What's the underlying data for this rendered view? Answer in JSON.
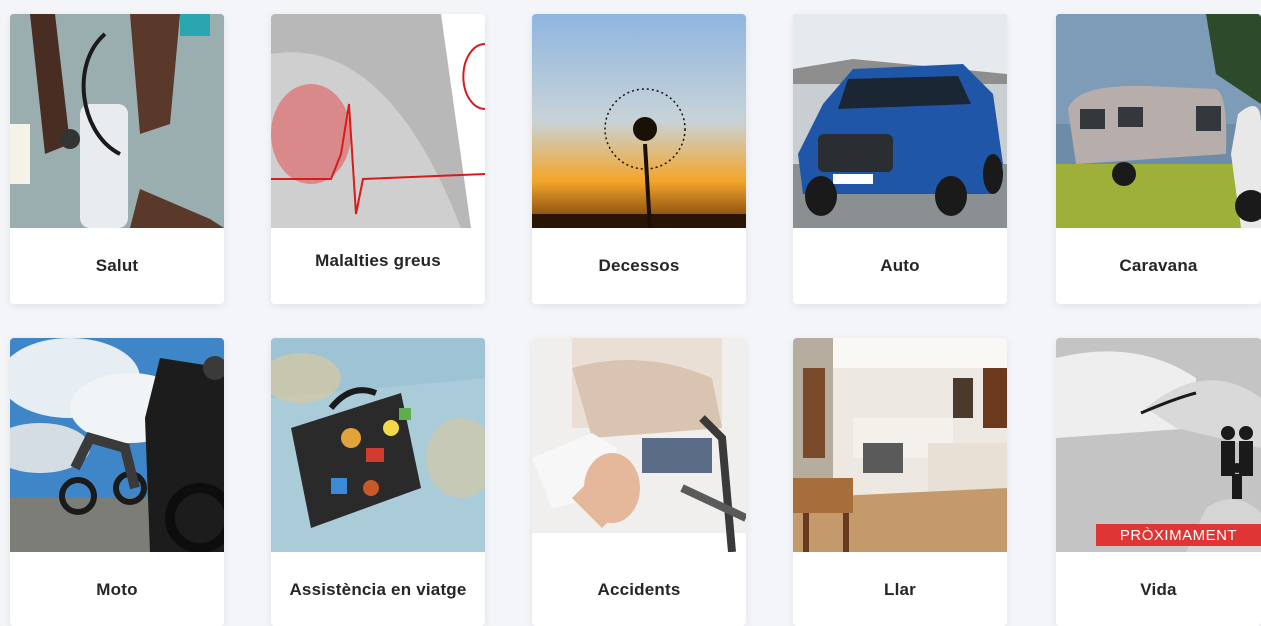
{
  "cards": [
    {
      "label": "Salut",
      "icon": "blood-pressure-photo"
    },
    {
      "label": "Malalties greus",
      "icon": "heartbeat-photo"
    },
    {
      "label": "Decessos",
      "icon": "dandelion-sunset-photo"
    },
    {
      "label": "Auto",
      "icon": "suv-car-photo"
    },
    {
      "label": "Caravana",
      "icon": "caravan-photo"
    },
    {
      "label": "Moto",
      "icon": "motorcycles-photo"
    },
    {
      "label": "Assistència en viatge",
      "icon": "suitcase-map-photo"
    },
    {
      "label": "Accidents",
      "icon": "injured-leg-photo"
    },
    {
      "label": "Llar",
      "icon": "kitchen-photo"
    },
    {
      "label": "Vida",
      "icon": "protecting-hands-family-photo",
      "badge": "PRÒXIMAMENT"
    }
  ]
}
